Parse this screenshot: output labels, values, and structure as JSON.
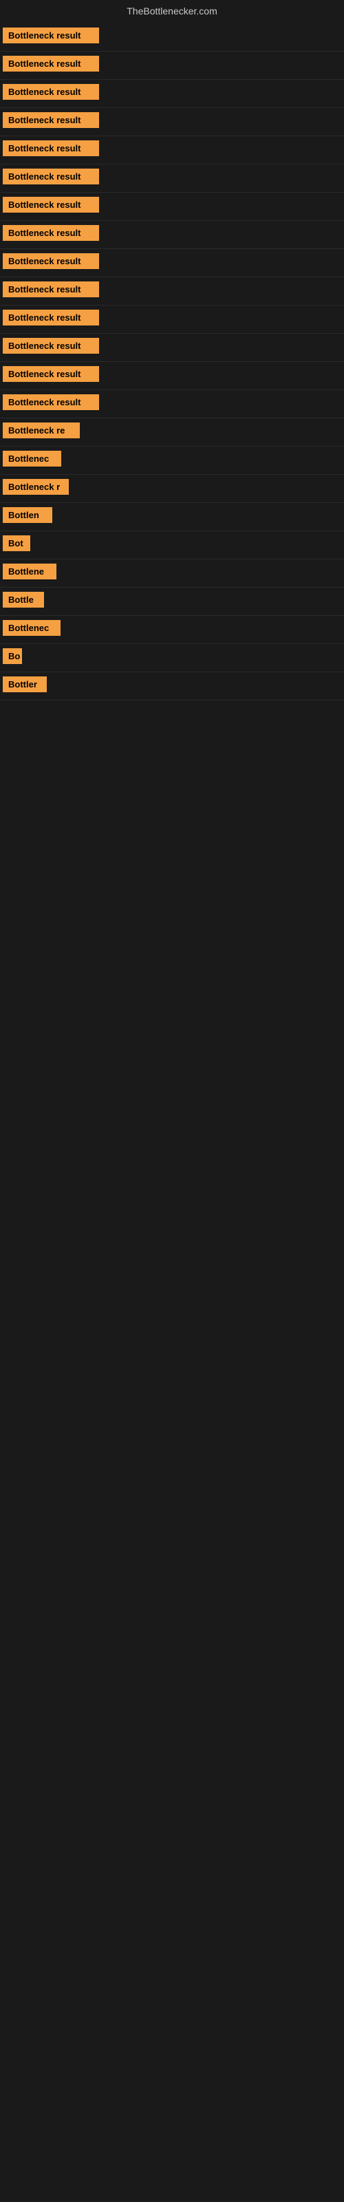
{
  "site": {
    "title": "TheBottlenecker.com"
  },
  "rows": [
    {
      "label": "Bottleneck result",
      "width": 140
    },
    {
      "label": "Bottleneck result",
      "width": 140
    },
    {
      "label": "Bottleneck result",
      "width": 140
    },
    {
      "label": "Bottleneck result",
      "width": 140
    },
    {
      "label": "Bottleneck result",
      "width": 140
    },
    {
      "label": "Bottleneck result",
      "width": 140
    },
    {
      "label": "Bottleneck result",
      "width": 140
    },
    {
      "label": "Bottleneck result",
      "width": 140
    },
    {
      "label": "Bottleneck result",
      "width": 140
    },
    {
      "label": "Bottleneck result",
      "width": 140
    },
    {
      "label": "Bottleneck result",
      "width": 140
    },
    {
      "label": "Bottleneck result",
      "width": 140
    },
    {
      "label": "Bottleneck result",
      "width": 140
    },
    {
      "label": "Bottleneck result",
      "width": 140
    },
    {
      "label": "Bottleneck re",
      "width": 112
    },
    {
      "label": "Bottlenec",
      "width": 85
    },
    {
      "label": "Bottleneck r",
      "width": 96
    },
    {
      "label": "Bottlen",
      "width": 72
    },
    {
      "label": "Bot",
      "width": 40
    },
    {
      "label": "Bottlene",
      "width": 78
    },
    {
      "label": "Bottle",
      "width": 60
    },
    {
      "label": "Bottlenec",
      "width": 84
    },
    {
      "label": "Bo",
      "width": 28
    },
    {
      "label": "Bottler",
      "width": 64
    }
  ],
  "colors": {
    "bar_bg": "#f5a042",
    "bar_text": "#000000",
    "page_bg": "#1a1a1a",
    "header_text": "#c8c8c8"
  }
}
